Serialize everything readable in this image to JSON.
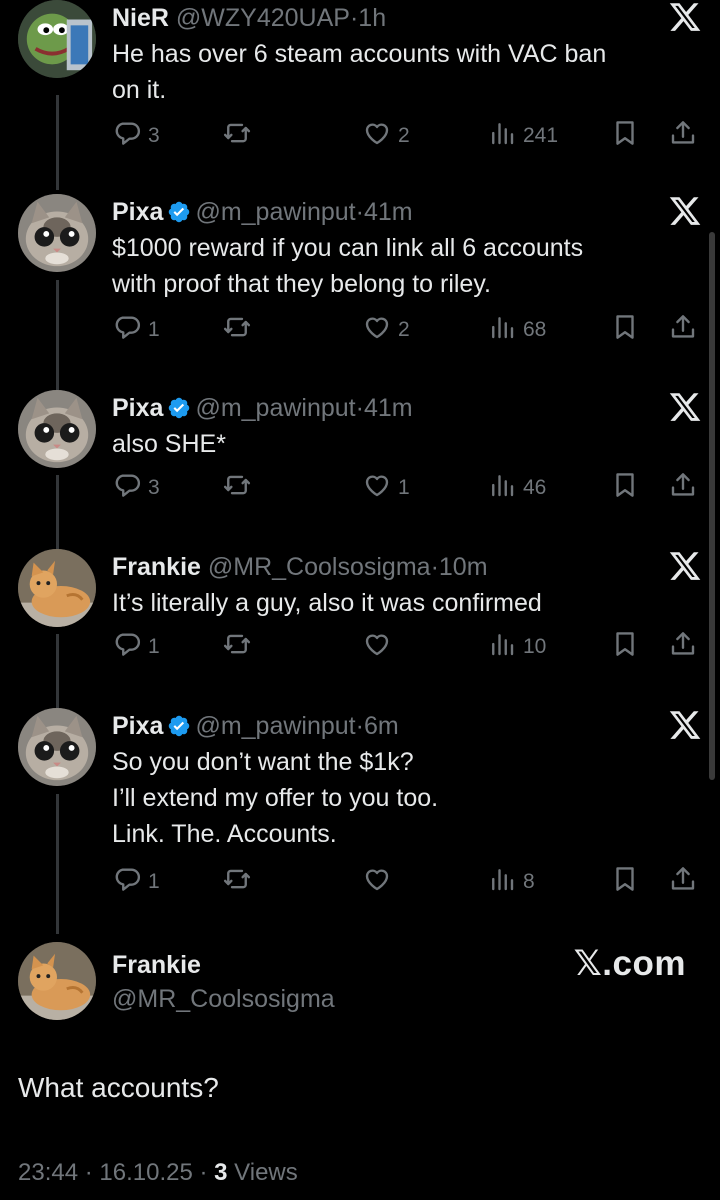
{
  "tweets": [
    {
      "name": "NieR",
      "handle": "@WZY420UAP",
      "dot": "·",
      "time": "1h",
      "verified": false,
      "avatar": "frog-avatar",
      "text": "He has over 6 steam accounts with VAC ban\non it.",
      "replies": "3",
      "retweets": "",
      "likes": "2",
      "views": "241"
    },
    {
      "name": "Pixa",
      "handle": "@m_pawinput",
      "dot": "·",
      "time": "41m",
      "verified": true,
      "avatar": "cat-avatar",
      "text": "$1000 reward if you can link all 6 accounts\nwith proof that they belong to riley.",
      "replies": "1",
      "retweets": "",
      "likes": "2",
      "views": "68"
    },
    {
      "name": "Pixa",
      "handle": "@m_pawinput",
      "dot": "·",
      "time": "41m",
      "verified": true,
      "avatar": "cat-avatar",
      "text": "also SHE*",
      "replies": "3",
      "retweets": "",
      "likes": "1",
      "views": "46"
    },
    {
      "name": "Frankie",
      "handle": "@MR_Coolsosigma",
      "dot": "·",
      "time": "10m",
      "verified": false,
      "avatar": "ginger-cat-avatar",
      "text": "It’s literally a guy, also it was confirmed",
      "replies": "1",
      "retweets": "",
      "likes": "",
      "views": "10"
    },
    {
      "name": "Pixa",
      "handle": "@m_pawinput",
      "dot": "·",
      "time": "6m",
      "verified": true,
      "avatar": "cat-avatar",
      "text": "So you don’t want the $1k?\nI’ll extend my offer to you too.\nLink. The. Accounts.",
      "replies": "1",
      "retweets": "",
      "likes": "",
      "views": "8"
    }
  ],
  "final": {
    "name": "Frankie",
    "handle": "@MR_Coolsosigma",
    "brand": "𝕏.com",
    "text": "What accounts?",
    "time": "23:44",
    "sep1": " · ",
    "date": "16.10.25",
    "sep2": " · ",
    "views_count": "3",
    "views_label": " Views"
  },
  "colors": {
    "background": "#000000",
    "text": "#e7e9ea",
    "muted": "#71767b",
    "verified": "#1d9bf0"
  }
}
